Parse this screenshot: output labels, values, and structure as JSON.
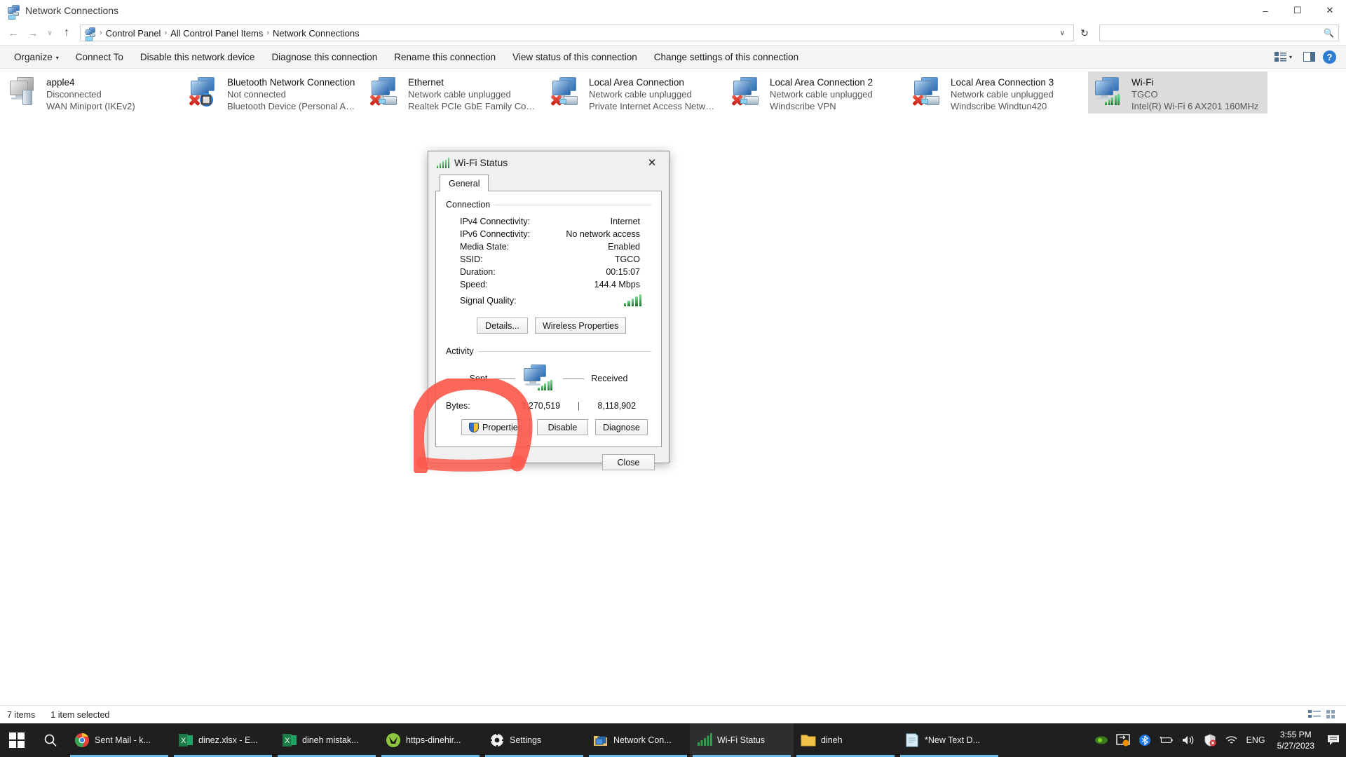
{
  "window": {
    "title": "Network Connections",
    "icon": "network-connections-icon",
    "controls": {
      "minimize": "–",
      "maximize": "☐",
      "close": "✕"
    }
  },
  "address_bar": {
    "back": "←",
    "forward": "→",
    "recent": "∨",
    "up": "↑",
    "breadcrumbs": [
      "Control Panel",
      "All Control Panel Items",
      "Network Connections"
    ],
    "separator": "›",
    "dropdown_caret": "∨",
    "refresh": "↻",
    "search_placeholder": "",
    "search_value": "",
    "search_icon": "search-icon"
  },
  "command_bar": {
    "items": [
      {
        "label": "Organize",
        "has_caret": true
      },
      {
        "label": "Connect To",
        "has_caret": false
      },
      {
        "label": "Disable this network device",
        "has_caret": false
      },
      {
        "label": "Diagnose this connection",
        "has_caret": false
      },
      {
        "label": "Rename this connection",
        "has_caret": false
      },
      {
        "label": "View status of this connection",
        "has_caret": false
      },
      {
        "label": "Change settings of this connection",
        "has_caret": false
      }
    ],
    "caret": "▾",
    "view_icon": "view-options-icon",
    "view_caret": "▾",
    "preview_pane_icon": "preview-pane-icon",
    "help_icon": "?",
    "help_label": "Help"
  },
  "adapters": [
    {
      "name": "apple4",
      "status": "Disconnected",
      "device": "WAN Miniport (IKEv2)",
      "icon": "wan-miniport-icon",
      "selected": false,
      "style": "gray-wan"
    },
    {
      "name": "Bluetooth Network Connection",
      "status": "Not connected",
      "device": "Bluetooth Device (Personal Area ...",
      "icon": "bluetooth-adapter-icon",
      "selected": false,
      "style": "bluetooth"
    },
    {
      "name": "Ethernet",
      "status": "Network cable unplugged",
      "device": "Realtek PCIe GbE Family Controller",
      "icon": "ethernet-adapter-icon",
      "selected": false,
      "style": "ethernet"
    },
    {
      "name": "Local Area Connection",
      "status": "Network cable unplugged",
      "device": "Private Internet Access Network A...",
      "icon": "ethernet-adapter-icon",
      "selected": false,
      "style": "ethernet"
    },
    {
      "name": "Local Area Connection 2",
      "status": "Network cable unplugged",
      "device": "Windscribe VPN",
      "icon": "ethernet-adapter-icon",
      "selected": false,
      "style": "ethernet"
    },
    {
      "name": "Local Area Connection 3",
      "status": "Network cable unplugged",
      "device": "Windscribe Windtun420",
      "icon": "ethernet-adapter-icon",
      "selected": false,
      "style": "ethernet"
    },
    {
      "name": "Wi-Fi",
      "status": "TGCO",
      "device": "Intel(R) Wi-Fi 6 AX201 160MHz",
      "icon": "wifi-adapter-icon",
      "selected": true,
      "style": "wifi"
    }
  ],
  "status_bar": {
    "item_count": "7 items",
    "selection": "1 item selected",
    "details_view_icon": "details-view-icon",
    "large_icons_view_icon": "large-icons-view-icon"
  },
  "dialog": {
    "title": "Wi-Fi Status",
    "icon": "wifi-signal-icon",
    "close": "✕",
    "tabs": [
      {
        "label": "General",
        "active": true
      }
    ],
    "connection": {
      "group_label": "Connection",
      "rows": [
        {
          "label": "IPv4 Connectivity:",
          "value": "Internet"
        },
        {
          "label": "IPv6 Connectivity:",
          "value": "No network access"
        },
        {
          "label": "Media State:",
          "value": "Enabled"
        },
        {
          "label": "SSID:",
          "value": "TGCO"
        },
        {
          "label": "Duration:",
          "value": "00:15:07"
        },
        {
          "label": "Speed:",
          "value": "144.4 Mbps"
        }
      ],
      "signal_quality_label": "Signal Quality:",
      "signal_bars": 5,
      "signal_bars_total": 5,
      "buttons": [
        {
          "label": "Details...",
          "icon": ""
        },
        {
          "label": "Wireless Properties",
          "icon": ""
        }
      ]
    },
    "activity": {
      "group_label": "Activity",
      "sent_label": "Sent",
      "received_label": "Received",
      "diagram_icon": "network-traffic-icon",
      "bytes_label": "Bytes:",
      "bytes_sent": "3,270,519",
      "bytes_separator": "|",
      "bytes_received": "8,118,902"
    },
    "action_buttons": [
      {
        "label": "Properties",
        "icon": "shield-icon",
        "highlighted": true
      },
      {
        "label": "Disable",
        "icon": ""
      },
      {
        "label": "Diagnose",
        "icon": ""
      }
    ],
    "close_button": "Close"
  },
  "annotation": {
    "type": "hand-drawn-circle",
    "color": "#fb5a4d",
    "target": "Properties"
  },
  "taskbar": {
    "start_icon": "windows-start-icon",
    "search_icon": "search-icon",
    "items": [
      {
        "label": "Sent Mail - k...",
        "icon": "chrome-icon",
        "active": false
      },
      {
        "label": "dinez.xlsx - E...",
        "icon": "excel-icon",
        "active": false
      },
      {
        "label": "dineh mistak...",
        "icon": "excel-icon",
        "active": false
      },
      {
        "label": "https-dinehir...",
        "icon": "app-icon",
        "active": false
      },
      {
        "label": "Settings",
        "icon": "settings-gear-icon",
        "active": false
      },
      {
        "label": "Network Con...",
        "icon": "network-connections-icon",
        "active": false
      },
      {
        "label": "Wi-Fi Status",
        "icon": "wifi-signal-icon",
        "active": true
      },
      {
        "label": "dineh",
        "icon": "folder-icon",
        "active": false
      },
      {
        "label": "*New Text D...",
        "icon": "notepad-icon",
        "active": false
      }
    ],
    "tray": [
      {
        "icon": "nvidia-icon",
        "name": "nvidia-tray-icon"
      },
      {
        "icon": "sync-icon",
        "name": "onedrive-tray-icon"
      },
      {
        "icon": "bluetooth-icon",
        "name": "bluetooth-tray-icon"
      },
      {
        "icon": "battery-icon",
        "name": "battery-tray-icon"
      },
      {
        "icon": "volume-icon",
        "name": "volume-tray-icon"
      },
      {
        "icon": "shield-icon",
        "name": "security-tray-icon"
      },
      {
        "icon": "wifi-icon",
        "name": "network-tray-icon"
      }
    ],
    "language": "ENG",
    "time": "3:55 PM",
    "date": "5/27/2023",
    "notification_icon": "notifications-icon"
  }
}
